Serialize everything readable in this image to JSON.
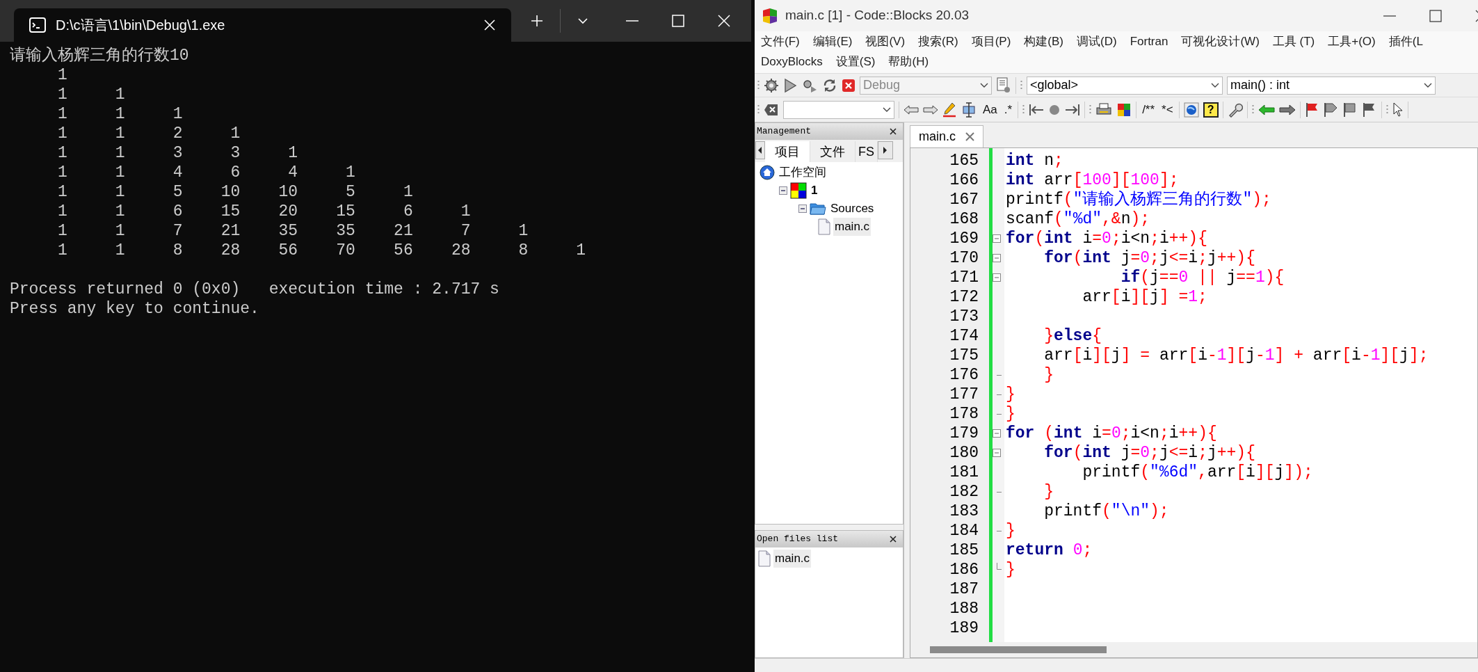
{
  "console": {
    "title": "D:\\c语言\\1\\bin\\Debug\\1.exe",
    "output_lines": [
      "请输入杨辉三角的行数10",
      "     1",
      "     1     1",
      "     1     1     1",
      "     1     1     2     1",
      "     1     1     3     3     1",
      "     1     1     4     6     4     1",
      "     1     1     5    10    10     5     1",
      "     1     1     6    15    20    15     6     1",
      "     1     1     7    21    35    35    21     7     1",
      "     1     1     8    28    56    70    56    28     8     1"
    ],
    "status_lines": [
      "Process returned 0 (0x0)   execution time : 2.717 s",
      "Press any key to continue."
    ]
  },
  "ide": {
    "title": "main.c [1] - Code::Blocks 20.03",
    "menu_rows": [
      [
        "文件(F)",
        "编辑(E)",
        "视图(V)",
        "搜索(R)",
        "项目(P)",
        "构建(B)",
        "调试(D)",
        "Fortran",
        "可视化设计(W)",
        "工具 (T)",
        "工具+(O)",
        "插件(L"
      ],
      [
        "DoxyBlocks",
        "设置(S)",
        "帮助(H)"
      ]
    ],
    "build_target": {
      "value": "Debug",
      "disabled": true
    },
    "scope": "<global>",
    "function": "main() : int",
    "text_buttons": [
      "Aa",
      ".*",
      "/**",
      "*<"
    ],
    "help_glyph": "?",
    "management": {
      "title": "Management",
      "tabs": [
        {
          "label": "项目",
          "selected": true
        },
        {
          "label": "文件",
          "selected": false
        },
        {
          "label": "FS",
          "selected": false
        }
      ],
      "tree": [
        {
          "kind": "workspace",
          "label": "工作空间",
          "selected": false,
          "children": [
            {
              "kind": "project",
              "label": "1",
              "selected": false,
              "expanded": true,
              "children": [
                {
                  "kind": "folder",
                  "label": "Sources",
                  "selected": false,
                  "expanded": true,
                  "children": [
                    {
                      "kind": "file",
                      "label": "main.c",
                      "selected": true
                    }
                  ]
                }
              ]
            }
          ]
        }
      ]
    },
    "open_files": {
      "title": "Open files list",
      "files": [
        {
          "label": "main.c",
          "selected": true
        }
      ]
    },
    "editor": {
      "tabs": [
        {
          "label": "main.c",
          "selected": true
        }
      ],
      "lines": [
        {
          "no": "165",
          "tokens": [
            {
              "kw": "int"
            },
            {
              "id": " n"
            },
            {
              "op": ";"
            }
          ]
        },
        {
          "no": "166",
          "tokens": [
            {
              "kw": "int"
            },
            {
              "id": " arr"
            },
            {
              "op": "["
            },
            {
              "num": "100"
            },
            {
              "op": "]["
            },
            {
              "num": "100"
            },
            {
              "op": "];"
            }
          ]
        },
        {
          "no": "167",
          "tokens": [
            {
              "id": "printf"
            },
            {
              "op": "("
            },
            {
              "str": "\"请输入杨辉三角的行数\""
            },
            {
              "op": ");"
            }
          ]
        },
        {
          "no": "168",
          "tokens": [
            {
              "id": "scanf"
            },
            {
              "op": "("
            },
            {
              "str": "\"%d\""
            },
            {
              "op": ",&"
            },
            {
              "id": "n"
            },
            {
              "op": ");"
            }
          ]
        },
        {
          "no": "169",
          "fold_start": true,
          "tokens": [
            {
              "kw": "for"
            },
            {
              "op": "("
            },
            {
              "kw": "int"
            },
            {
              "id": " i"
            },
            {
              "op": "="
            },
            {
              "num": "0"
            },
            {
              "op": ";"
            },
            {
              "id": "i<n"
            },
            {
              "op": ";"
            },
            {
              "id": "i"
            },
            {
              "op": "++){"
            }
          ]
        },
        {
          "no": "170",
          "fold_start": true,
          "tokens": [
            {
              "kw": "    for"
            },
            {
              "op": "("
            },
            {
              "kw": "int"
            },
            {
              "id": " j"
            },
            {
              "op": "="
            },
            {
              "num": "0"
            },
            {
              "op": ";"
            },
            {
              "id": "j"
            },
            {
              "op": "<="
            },
            {
              "id": "i"
            },
            {
              "op": ";"
            },
            {
              "id": "j"
            },
            {
              "op": "++){"
            }
          ]
        },
        {
          "no": "171",
          "fold_start": true,
          "tokens": [
            {
              "kw": "            if"
            },
            {
              "op": "("
            },
            {
              "id": "j"
            },
            {
              "op": "=="
            },
            {
              "num": "0"
            },
            {
              "op": " || "
            },
            {
              "id": "j"
            },
            {
              "op": "=="
            },
            {
              "num": "1"
            },
            {
              "op": "){"
            }
          ]
        },
        {
          "no": "172",
          "tokens": [
            {
              "id": "        arr"
            },
            {
              "op": "["
            },
            {
              "id": "i"
            },
            {
              "op": "]["
            },
            {
              "id": "j"
            },
            {
              "op": "] ="
            },
            {
              "num": "1"
            },
            {
              "op": ";"
            }
          ]
        },
        {
          "no": "173"
        },
        {
          "no": "174",
          "tokens": [
            {
              "op": "    }"
            },
            {
              "kw": "else"
            },
            {
              "op": "{"
            }
          ]
        },
        {
          "no": "175",
          "tokens": [
            {
              "id": "    arr"
            },
            {
              "op": "["
            },
            {
              "id": "i"
            },
            {
              "op": "]["
            },
            {
              "id": "j"
            },
            {
              "op": "] = "
            },
            {
              "id": "arr"
            },
            {
              "op": "["
            },
            {
              "id": "i"
            },
            {
              "op": "-"
            },
            {
              "num": "1"
            },
            {
              "op": "]["
            },
            {
              "id": "j"
            },
            {
              "op": "-"
            },
            {
              "num": "1"
            },
            {
              "op": "] + "
            },
            {
              "id": "arr"
            },
            {
              "op": "["
            },
            {
              "id": "i"
            },
            {
              "op": "-"
            },
            {
              "num": "1"
            },
            {
              "op": "]["
            },
            {
              "id": "j"
            },
            {
              "op": "];"
            }
          ]
        },
        {
          "no": "176",
          "fold_end": true,
          "tokens": [
            {
              "op": "    }"
            }
          ]
        },
        {
          "no": "177",
          "fold_end": true,
          "tokens": [
            {
              "op": "}"
            }
          ]
        },
        {
          "no": "178",
          "fold_end": true,
          "tokens": [
            {
              "op": "}"
            }
          ]
        },
        {
          "no": "179",
          "fold_start": true,
          "tokens": [
            {
              "kw": "for"
            },
            {
              "op": " ("
            },
            {
              "kw": "int"
            },
            {
              "id": " i"
            },
            {
              "op": "="
            },
            {
              "num": "0"
            },
            {
              "op": ";"
            },
            {
              "id": "i<n"
            },
            {
              "op": ";"
            },
            {
              "id": "i"
            },
            {
              "op": "++){"
            }
          ]
        },
        {
          "no": "180",
          "fold_start": true,
          "tokens": [
            {
              "kw": "    for"
            },
            {
              "op": "("
            },
            {
              "kw": "int"
            },
            {
              "id": " j"
            },
            {
              "op": "="
            },
            {
              "num": "0"
            },
            {
              "op": ";"
            },
            {
              "id": "j"
            },
            {
              "op": "<="
            },
            {
              "id": "i"
            },
            {
              "op": ";"
            },
            {
              "id": "j"
            },
            {
              "op": "++){"
            }
          ]
        },
        {
          "no": "181",
          "tokens": [
            {
              "id": "        printf"
            },
            {
              "op": "("
            },
            {
              "str": "\"%6d\""
            },
            {
              "op": ","
            },
            {
              "id": "arr"
            },
            {
              "op": "["
            },
            {
              "id": "i"
            },
            {
              "op": "]["
            },
            {
              "id": "j"
            },
            {
              "op": "]);"
            }
          ]
        },
        {
          "no": "182",
          "fold_end": true,
          "tokens": [
            {
              "op": "    }"
            }
          ]
        },
        {
          "no": "183",
          "tokens": [
            {
              "id": "    printf"
            },
            {
              "op": "("
            },
            {
              "str": "\"\\n\""
            },
            {
              "op": ");"
            }
          ]
        },
        {
          "no": "184",
          "fold_end": true,
          "tokens": [
            {
              "op": "}"
            }
          ]
        },
        {
          "no": "185",
          "tokens": [
            {
              "kw": "return"
            },
            {
              "num": " 0"
            },
            {
              "op": ";"
            }
          ]
        },
        {
          "no": "186",
          "fold_end": true,
          "tokens": [
            {
              "op": "}"
            }
          ]
        },
        {
          "no": "187"
        },
        {
          "no": "188"
        },
        {
          "no": "189"
        }
      ]
    }
  }
}
